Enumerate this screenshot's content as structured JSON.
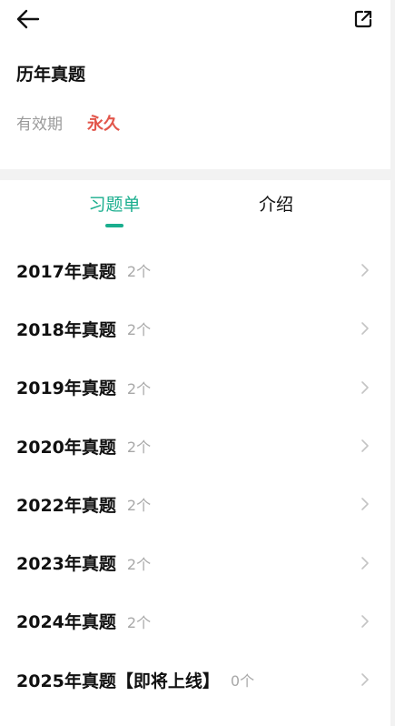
{
  "header": {
    "back_icon": "arrow-left-icon",
    "share_icon": "external-link-icon"
  },
  "info": {
    "title": "历年真题",
    "validity_label": "有效期",
    "validity_value": "永久",
    "validity_color": "#e2574c"
  },
  "tabs": [
    {
      "label": "习题单",
      "active": true
    },
    {
      "label": "介绍",
      "active": false
    }
  ],
  "accent_color": "#1aae8e",
  "items": [
    {
      "title": "2017年真题",
      "count": "2个"
    },
    {
      "title": "2018年真题",
      "count": "2个"
    },
    {
      "title": "2019年真题",
      "count": "2个"
    },
    {
      "title": "2020年真题",
      "count": "2个"
    },
    {
      "title": "2022年真题",
      "count": "2个"
    },
    {
      "title": "2023年真题",
      "count": "2个"
    },
    {
      "title": "2024年真题",
      "count": "2个"
    },
    {
      "title": "2025年真题【即将上线】",
      "count": "0个"
    }
  ]
}
